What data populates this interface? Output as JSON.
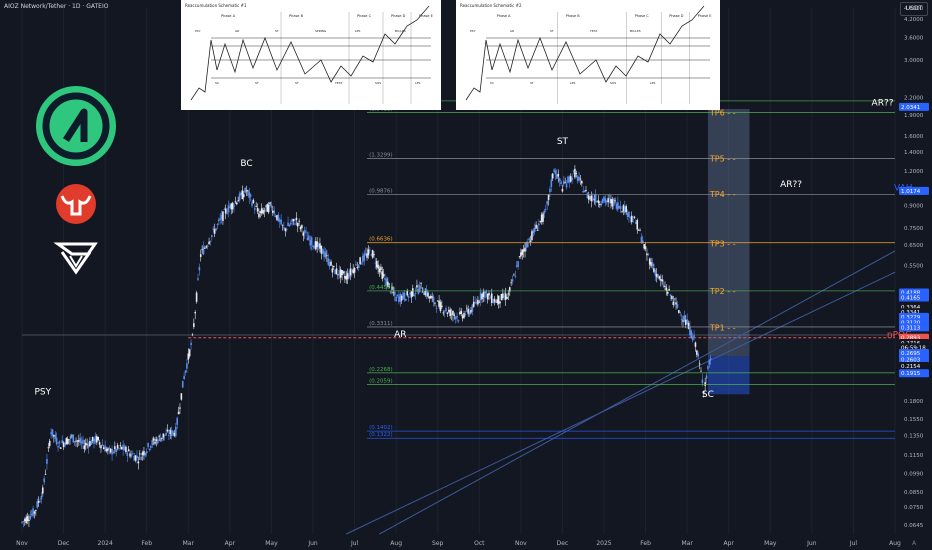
{
  "header": {
    "title": "AIOZ Network/Tether · 1D · GATEIO",
    "unit": "USDT",
    "corner": "A"
  },
  "schematics": [
    {
      "title": "Reaccumulation Schematic #1",
      "phases": [
        "Phase A",
        "Phase B",
        "Phase C",
        "Phase D",
        "Phase E"
      ],
      "labels": [
        "PSY",
        "SC",
        "AR",
        "ST",
        "ST",
        "ST",
        "SPRING",
        "TEST",
        "LPS",
        "SOS",
        "BU/LPS",
        "LPS"
      ]
    },
    {
      "title": "Reaccumulation Schematic #2",
      "phases": [
        "Phase A",
        "Phase B",
        "Phase C",
        "Phase D",
        "Phase E"
      ],
      "labels": [
        "PSY",
        "SC",
        "AR",
        "ST",
        "ST",
        "LPS",
        "TEST",
        "SOS",
        "BU/LPS",
        "LPS"
      ]
    }
  ],
  "colors": {
    "bg": "#131722",
    "up": "#5b8def",
    "down": "#ffffff",
    "fib": "#4caf50",
    "gold": "#f0a830",
    "tp": "#ffa726",
    "poc": "#ef5350",
    "mo": "#ab47bc",
    "vah": "#2962ff"
  },
  "icons": [
    "logo-icon",
    "bull-icon",
    "tv-icon"
  ],
  "chart_data": {
    "type": "candlestick",
    "title": "AIOZ Network/Tether · 1D · GATEIO",
    "scale": "log",
    "ylim": [
      0.06,
      4.6
    ],
    "xlim_months": [
      0,
      21
    ],
    "x_ticks": [
      {
        "label": "Nov",
        "m": 0
      },
      {
        "label": "Dec",
        "m": 1
      },
      {
        "label": "2024",
        "m": 2
      },
      {
        "label": "Feb",
        "m": 3
      },
      {
        "label": "Mar",
        "m": 4
      },
      {
        "label": "Apr",
        "m": 5
      },
      {
        "label": "May",
        "m": 6
      },
      {
        "label": "Jun",
        "m": 7
      },
      {
        "label": "Jul",
        "m": 8
      },
      {
        "label": "Aug",
        "m": 9
      },
      {
        "label": "Sep",
        "m": 10
      },
      {
        "label": "Oct",
        "m": 11
      },
      {
        "label": "Nov",
        "m": 12
      },
      {
        "label": "Dec",
        "m": 13
      },
      {
        "label": "2025",
        "m": 14
      },
      {
        "label": "Feb",
        "m": 15
      },
      {
        "label": "Mar",
        "m": 16
      },
      {
        "label": "Apr",
        "m": 17
      },
      {
        "label": "May",
        "m": 18
      },
      {
        "label": "Jun",
        "m": 19
      },
      {
        "label": "Jul",
        "m": 20
      },
      {
        "label": "Aug",
        "m": 21
      }
    ],
    "y_ticks": [
      "4.6000",
      "4.2000",
      "3.6000",
      "3.0000",
      "2.2000",
      "1.9000",
      "1.6000",
      "1.4000",
      "1.2000",
      "1.0000",
      "0.9000",
      "0.7500",
      "0.6500",
      "0.5500",
      "0.1800",
      "0.1550",
      "0.1350",
      "0.1150",
      "0.0990",
      "0.0850",
      "0.0750",
      "0.0645"
    ],
    "y_tick_values": [
      4.6,
      4.2,
      3.6,
      3.0,
      2.2,
      1.9,
      1.6,
      1.4,
      1.2,
      1.0,
      0.9,
      0.75,
      0.65,
      0.55,
      0.18,
      0.155,
      0.135,
      0.115,
      0.099,
      0.085,
      0.075,
      0.0645
    ],
    "price_tags": [
      {
        "label": "2.0341",
        "v": 2.0341,
        "c": "#2962ff"
      },
      {
        "label": "1.0174",
        "v": 1.0174,
        "c": "#2962ff"
      },
      {
        "label": "0.4188",
        "v": 0.44,
        "c": "#2962ff"
      },
      {
        "label": "0.4165",
        "v": 0.422,
        "c": "#2962ff"
      },
      {
        "label": "0.3364",
        "v": 0.39,
        "c": "#131722"
      },
      {
        "label": "0.3341",
        "v": 0.374,
        "c": "#131722"
      },
      {
        "label": "0.3229",
        "v": 0.36,
        "c": "#2962ff"
      },
      {
        "label": "0.3120",
        "v": 0.344,
        "c": "#2962ff"
      },
      {
        "label": "0.3113",
        "v": 0.33,
        "c": "#2962ff"
      },
      {
        "label": "0.2893",
        "v": 0.303,
        "c": "#ef5350"
      },
      {
        "label": "0.2716",
        "v": 0.29,
        "c": "#131722"
      },
      {
        "label": "06:59:18",
        "v": 0.28,
        "c": "#131722"
      },
      {
        "label": "0.2695",
        "v": 0.267,
        "c": "#2962ff"
      },
      {
        "label": "0.2603",
        "v": 0.253,
        "c": "#2962ff"
      },
      {
        "label": "0.2154",
        "v": 0.24,
        "c": "#131722"
      },
      {
        "label": "0.1915",
        "v": 0.226,
        "c": "#2962ff"
      }
    ],
    "fib_levels": [
      {
        "label": "(2.1377)",
        "v": 2.1377,
        "c": "#4caf50"
      },
      {
        "label": "(1.9411)",
        "v": 1.9411,
        "c": "#4caf50"
      },
      {
        "label": "(1.3299)",
        "v": 1.3299,
        "c": "#8a8f98"
      },
      {
        "label": "(0.9876)",
        "v": 0.9876,
        "c": "#8a8f98"
      },
      {
        "label": "(0.6636)",
        "v": 0.6636,
        "c": "#f0a830"
      },
      {
        "label": "(0.4459)",
        "v": 0.4459,
        "c": "#4caf50"
      },
      {
        "label": "(0.3311)",
        "v": 0.3311,
        "c": "#8a8f98"
      },
      {
        "label": "(0.2268)",
        "v": 0.2268,
        "c": "#4caf50"
      },
      {
        "label": "(0.2059)",
        "v": 0.2059,
        "c": "#4caf50"
      },
      {
        "label": "(0.1402)",
        "v": 0.1402,
        "c": "#2962ff"
      },
      {
        "label": "(0.1322)",
        "v": 0.1322,
        "c": "#2962ff"
      }
    ],
    "tp_targets": [
      {
        "label": "TP6",
        "v": 1.94
      },
      {
        "label": "TP5",
        "v": 1.33
      },
      {
        "label": "TP4",
        "v": 0.99
      },
      {
        "label": "TP3",
        "v": 0.66
      },
      {
        "label": "TP2",
        "v": 0.445
      },
      {
        "label": "TP1",
        "v": 0.33
      }
    ],
    "annotations": [
      {
        "text": "PSY",
        "m": 0.5,
        "v": 0.19,
        "c": "#ffffff"
      },
      {
        "text": "BC",
        "m": 5.4,
        "v": 1.25,
        "c": "#ffffff"
      },
      {
        "text": "ST",
        "m": 13.0,
        "v": 1.5,
        "c": "#ffffff"
      },
      {
        "text": "AR",
        "m": 9.1,
        "v": 0.305,
        "c": "#ffffff"
      },
      {
        "text": "SC",
        "m": 16.5,
        "v": 0.186,
        "c": "#ffffff"
      },
      {
        "text": "AR??",
        "m": 18.5,
        "v": 1.05,
        "c": "#ffffff"
      },
      {
        "text": "AR??",
        "m": 20.7,
        "v": 2.06,
        "c": "#ffffff"
      },
      {
        "text": "VAH",
        "m": 21.2,
        "v": 1.02,
        "c": "#2962ff"
      },
      {
        "text": "nPOC",
        "m": 21.1,
        "v": 0.303,
        "c": "#ef5350"
      },
      {
        "text": "MO",
        "m": 21.3,
        "v": 0.287,
        "c": "#ab47bc"
      }
    ],
    "price_path": [
      [
        0,
        0.066
      ],
      [
        0.3,
        0.072
      ],
      [
        0.5,
        0.085
      ],
      [
        0.7,
        0.14
      ],
      [
        0.9,
        0.125
      ],
      [
        1.2,
        0.133
      ],
      [
        1.5,
        0.125
      ],
      [
        1.8,
        0.131
      ],
      [
        2.1,
        0.118
      ],
      [
        2.4,
        0.122
      ],
      [
        2.8,
        0.112
      ],
      [
        3.1,
        0.126
      ],
      [
        3.4,
        0.135
      ],
      [
        3.7,
        0.14
      ],
      [
        3.9,
        0.22
      ],
      [
        4.1,
        0.3
      ],
      [
        4.3,
        0.6
      ],
      [
        4.6,
        0.72
      ],
      [
        4.9,
        0.86
      ],
      [
        5.2,
        0.95
      ],
      [
        5.4,
        1.02
      ],
      [
        5.7,
        0.84
      ],
      [
        6.0,
        0.9
      ],
      [
        6.3,
        0.74
      ],
      [
        6.6,
        0.8
      ],
      [
        6.9,
        0.68
      ],
      [
        7.2,
        0.63
      ],
      [
        7.5,
        0.53
      ],
      [
        7.8,
        0.5
      ],
      [
        8.1,
        0.56
      ],
      [
        8.4,
        0.62
      ],
      [
        8.7,
        0.5
      ],
      [
        9.0,
        0.42
      ],
      [
        9.3,
        0.43
      ],
      [
        9.6,
        0.46
      ],
      [
        9.9,
        0.41
      ],
      [
        10.2,
        0.38
      ],
      [
        10.5,
        0.36
      ],
      [
        10.8,
        0.38
      ],
      [
        11.1,
        0.44
      ],
      [
        11.4,
        0.41
      ],
      [
        11.7,
        0.43
      ],
      [
        12.0,
        0.6
      ],
      [
        12.3,
        0.72
      ],
      [
        12.6,
        0.85
      ],
      [
        12.8,
        1.22
      ],
      [
        13.0,
        1.05
      ],
      [
        13.3,
        1.18
      ],
      [
        13.6,
        0.98
      ],
      [
        13.9,
        0.94
      ],
      [
        14.2,
        0.93
      ],
      [
        14.5,
        0.88
      ],
      [
        14.8,
        0.77
      ],
      [
        15.0,
        0.62
      ],
      [
        15.3,
        0.5
      ],
      [
        15.6,
        0.43
      ],
      [
        15.8,
        0.38
      ],
      [
        16.0,
        0.34
      ],
      [
        16.2,
        0.29
      ],
      [
        16.4,
        0.2
      ],
      [
        16.6,
        0.27
      ]
    ],
    "tp_box": {
      "m_start": 16.5,
      "m_end": 17.5,
      "top": 2.0,
      "bottom": 0.26
    },
    "sc_box": {
      "m_start": 16.5,
      "m_end": 17.5,
      "top": 0.26,
      "bottom": 0.19
    },
    "hlines": [
      {
        "v": 0.303,
        "c": "#ef5350",
        "dash": true,
        "from": 4.0
      },
      {
        "v": 0.31,
        "c": "#4a4f5a",
        "dash": false,
        "from": 0
      },
      {
        "v": 2.2,
        "c": "#2962ff",
        "dash": false,
        "from": 21
      }
    ]
  }
}
